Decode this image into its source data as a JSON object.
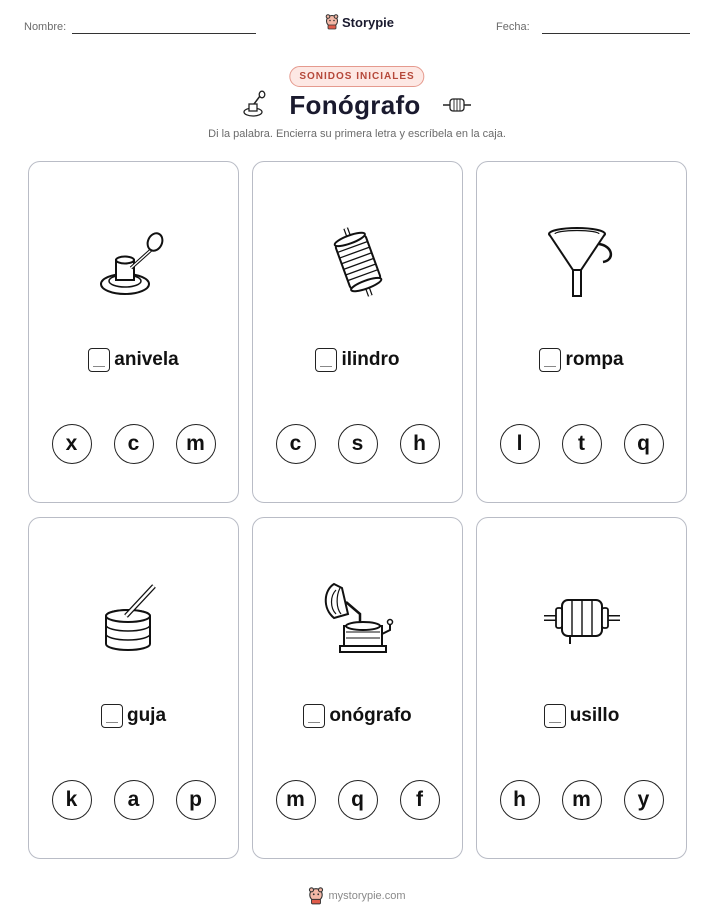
{
  "header": {
    "name_label": "Nombre:",
    "date_label": "Fecha:",
    "brand": "Storypie",
    "tag": "SONIDOS INICIALES",
    "title": "Fonógrafo",
    "instructions": "Di la palabra. Encierra su primera letra y escríbela en la caja."
  },
  "cards": [
    {
      "word": "anivela",
      "picture": "crank-icon",
      "choices": [
        "x",
        "c",
        "m"
      ]
    },
    {
      "word": "ilindro",
      "picture": "cylinder-icon",
      "choices": [
        "c",
        "s",
        "h"
      ]
    },
    {
      "word": "rompa",
      "picture": "funnel-icon",
      "choices": [
        "l",
        "t",
        "q"
      ]
    },
    {
      "word": "guja",
      "picture": "needle-icon",
      "choices": [
        "k",
        "a",
        "p"
      ]
    },
    {
      "word": "onógrafo",
      "picture": "phonograph-icon",
      "choices": [
        "m",
        "q",
        "f"
      ]
    },
    {
      "word": "usillo",
      "picture": "spindle-icon",
      "choices": [
        "h",
        "m",
        "y"
      ]
    }
  ],
  "footer": {
    "url": "mystorypie.com"
  }
}
